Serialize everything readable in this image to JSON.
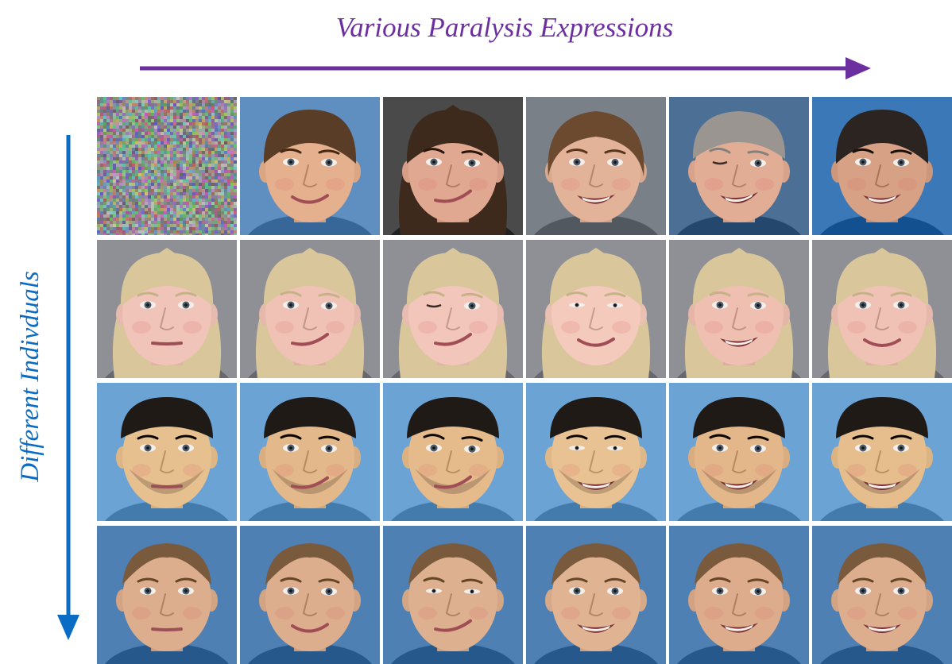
{
  "header": {
    "title": "Various Paralysis Expressions",
    "title_color": "#6b2fa0"
  },
  "side": {
    "title": "Different Indivduals",
    "title_color": "#0b6cc4"
  },
  "grid": {
    "rows": [
      {
        "cells": [
          {
            "type": "noise"
          },
          {
            "type": "face",
            "bg": "#5f8fc0",
            "skin": "#e4b08e",
            "hair": "#5a3d26",
            "hairStyle": "updo",
            "eyes": "open",
            "mouth": "smile",
            "asym": 0.3
          },
          {
            "type": "face",
            "bg": "#4a4a4a",
            "skin": "#e0a891",
            "hair": "#3e2a1c",
            "hairStyle": "long",
            "eyes": "open",
            "mouth": "smirk",
            "asym": 0.6
          },
          {
            "type": "face",
            "bg": "#7a8088",
            "skin": "#e3b399",
            "hair": "#6b4a30",
            "hairStyle": "bangs",
            "eyes": "open",
            "mouth": "grin",
            "asym": 0.2
          },
          {
            "type": "face",
            "bg": "#4c6f95",
            "skin": "#e2ad95",
            "hair": "#9a9590",
            "hairStyle": "short",
            "eyes": "wink",
            "mouth": "grin",
            "asym": 0.7
          },
          {
            "type": "face",
            "bg": "#3b78b8",
            "skin": "#d6a184",
            "hair": "#2b2420",
            "hairStyle": "updo",
            "eyes": "open",
            "mouth": "grin",
            "asym": 0.3
          }
        ]
      },
      {
        "cells": [
          {
            "type": "face",
            "bg": "#8e9096",
            "skin": "#f0c4b8",
            "hair": "#d9c69a",
            "hairStyle": "long",
            "eyes": "open",
            "mouth": "neutral",
            "asym": 0.0
          },
          {
            "type": "face",
            "bg": "#8e9096",
            "skin": "#f0c2b6",
            "hair": "#d9c69a",
            "hairStyle": "long",
            "eyes": "open",
            "mouth": "smirk",
            "asym": 0.5
          },
          {
            "type": "face",
            "bg": "#8e9096",
            "skin": "#f2c6ba",
            "hair": "#d9c69a",
            "hairStyle": "long",
            "eyes": "wink",
            "mouth": "smirk",
            "asym": 0.5
          },
          {
            "type": "face",
            "bg": "#8e9096",
            "skin": "#f3cabc",
            "hair": "#d9c69a",
            "hairStyle": "long",
            "eyes": "squint",
            "mouth": "smile",
            "asym": 0.2
          },
          {
            "type": "face",
            "bg": "#8e9096",
            "skin": "#efbfb2",
            "hair": "#d9c69a",
            "hairStyle": "long",
            "eyes": "open",
            "mouth": "grin",
            "asym": 0.3
          },
          {
            "type": "face",
            "bg": "#8e9096",
            "skin": "#f0c2b6",
            "hair": "#d9c69a",
            "hairStyle": "long",
            "eyes": "open",
            "mouth": "smile",
            "asym": 0.0
          }
        ]
      },
      {
        "cells": [
          {
            "type": "face",
            "bg": "#6aa3d4",
            "skin": "#e7c08f",
            "hair": "#1f1a16",
            "hairStyle": "buzz",
            "eyes": "open",
            "mouth": "neutral",
            "asym": 0.0,
            "beard": true
          },
          {
            "type": "face",
            "bg": "#6aa3d4",
            "skin": "#e3b88a",
            "hair": "#1f1a16",
            "hairStyle": "buzz",
            "eyes": "open",
            "mouth": "smirk",
            "asym": 0.4,
            "beard": true
          },
          {
            "type": "face",
            "bg": "#6aa3d4",
            "skin": "#e5bb8c",
            "hair": "#1f1a16",
            "hairStyle": "buzz",
            "eyes": "open",
            "mouth": "smirk",
            "asym": 0.6,
            "beard": true
          },
          {
            "type": "face",
            "bg": "#6aa3d4",
            "skin": "#e8c292",
            "hair": "#1f1a16",
            "hairStyle": "buzz",
            "eyes": "squint",
            "mouth": "grin",
            "asym": 0.1,
            "beard": true
          },
          {
            "type": "face",
            "bg": "#6aa3d4",
            "skin": "#e3b789",
            "hair": "#1f1a16",
            "hairStyle": "buzz",
            "eyes": "open",
            "mouth": "grin",
            "asym": 0.4,
            "beard": true
          },
          {
            "type": "face",
            "bg": "#6aa3d4",
            "skin": "#e6bd8d",
            "hair": "#1f1a16",
            "hairStyle": "buzz",
            "eyes": "open",
            "mouth": "grin",
            "asym": 0.0,
            "beard": true
          }
        ]
      },
      {
        "cells": [
          {
            "type": "face",
            "bg": "#4f80b3",
            "skin": "#dcae8e",
            "hair": "#7a5a3c",
            "hairStyle": "slick",
            "eyes": "open",
            "mouth": "neutral",
            "asym": 0.0
          },
          {
            "type": "face",
            "bg": "#4f80b3",
            "skin": "#dcae8e",
            "hair": "#7a5a3c",
            "hairStyle": "slick",
            "eyes": "open",
            "mouth": "smile",
            "asym": 0.3
          },
          {
            "type": "face",
            "bg": "#4f80b3",
            "skin": "#ddb090",
            "hair": "#7a5a3c",
            "hairStyle": "slick",
            "eyes": "squint",
            "mouth": "smirk",
            "asym": 0.4
          },
          {
            "type": "face",
            "bg": "#4f80b3",
            "skin": "#e0b393",
            "hair": "#7a5a3c",
            "hairStyle": "slick",
            "eyes": "open",
            "mouth": "grin",
            "asym": 0.1
          },
          {
            "type": "face",
            "bg": "#4f80b3",
            "skin": "#dcac8c",
            "hair": "#7a5a3c",
            "hairStyle": "slick",
            "eyes": "open",
            "mouth": "grin",
            "asym": 0.3
          },
          {
            "type": "face",
            "bg": "#4f80b3",
            "skin": "#ddae8e",
            "hair": "#7a5a3c",
            "hairStyle": "slick",
            "eyes": "open",
            "mouth": "grin",
            "asym": 0.0
          }
        ]
      }
    ]
  }
}
